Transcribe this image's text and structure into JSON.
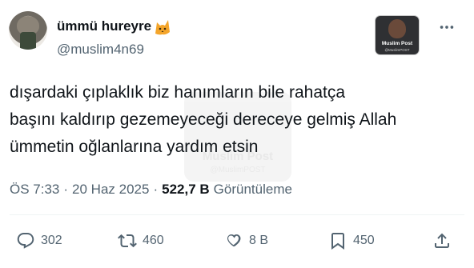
{
  "author": {
    "display_name": "ümmü hureyre",
    "handle": "@muslim4n69",
    "name_emoji_icon": "cat-face-icon"
  },
  "badge": {
    "title": "Muslim Post",
    "subtitle": "@MuslimPOST"
  },
  "watermark": {
    "title": "Muslim Post",
    "subtitle": "@MuslimPOST"
  },
  "tweet": {
    "lines": [
      "dışardaki çıplaklık biz hanımların bile rahatça",
      "başını kaldırıp gezemeyeceği dereceye gelmiş Allah",
      "ümmetin oğlanlarına yardım etsin"
    ]
  },
  "meta": {
    "time": "ÖS 7:33",
    "separator": "·",
    "date": "20 Haz 2025",
    "views_count": "522,7 B",
    "views_label": "Görüntüleme"
  },
  "actions": {
    "reply_count": "302",
    "retweet_count": "460",
    "like_count": "8 B",
    "bookmark_count": "450"
  },
  "colors": {
    "text_primary": "#0f1419",
    "text_secondary": "#536471",
    "divider": "#eff3f4"
  }
}
